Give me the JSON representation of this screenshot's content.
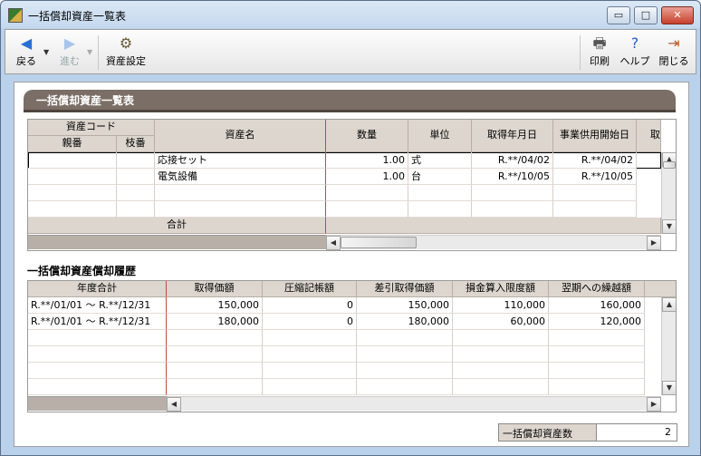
{
  "window": {
    "title": "一括償却資産一覧表"
  },
  "window_controls": {
    "minimize": "▭",
    "maximize": "□",
    "close": "✕"
  },
  "toolbar": {
    "back": "戻る",
    "forward": "進む",
    "asset_settings": "資産設定",
    "print": "印刷",
    "help": "ヘルプ",
    "close": "閉じる"
  },
  "section_title": "一括償却資産一覧表",
  "asset_table": {
    "headers": {
      "asset_code": "資産コード",
      "parent_no": "親番",
      "branch_no": "枝番",
      "asset_name": "資産名",
      "quantity": "数量",
      "unit": "単位",
      "acquired_date": "取得年月日",
      "in_service_date": "事業供用開始日",
      "cut_col": "取"
    },
    "rows": [
      {
        "parent": "",
        "branch": "",
        "name": "応接セット",
        "qty": "1.00",
        "unit": "式",
        "acquired": "R.**/04/02",
        "service": "R.**/04/02"
      },
      {
        "parent": "",
        "branch": "",
        "name": "電気設備",
        "qty": "1.00",
        "unit": "台",
        "acquired": "R.**/10/05",
        "service": "R.**/10/05"
      }
    ],
    "total_label": "合計"
  },
  "history_title": "一括償却資産償却履歴",
  "history_table": {
    "headers": {
      "fiscal_total": "年度合計",
      "acq_value": "取得価額",
      "compressed": "圧縮記帳額",
      "net_acq": "差引取得価額",
      "deductible": "損金算入限度額",
      "carryover": "翌期への繰越額"
    },
    "rows": [
      {
        "period": "R.**/01/01 ～ R.**/12/31",
        "acq": "150,000",
        "comp": "0",
        "net": "150,000",
        "ded": "110,000",
        "carry": "160,000"
      },
      {
        "period": "R.**/01/01 ～ R.**/12/31",
        "acq": "180,000",
        "comp": "0",
        "net": "180,000",
        "ded": "60,000",
        "carry": "120,000"
      }
    ]
  },
  "asset_count": {
    "label": "一括償却資産数",
    "value": "2"
  }
}
